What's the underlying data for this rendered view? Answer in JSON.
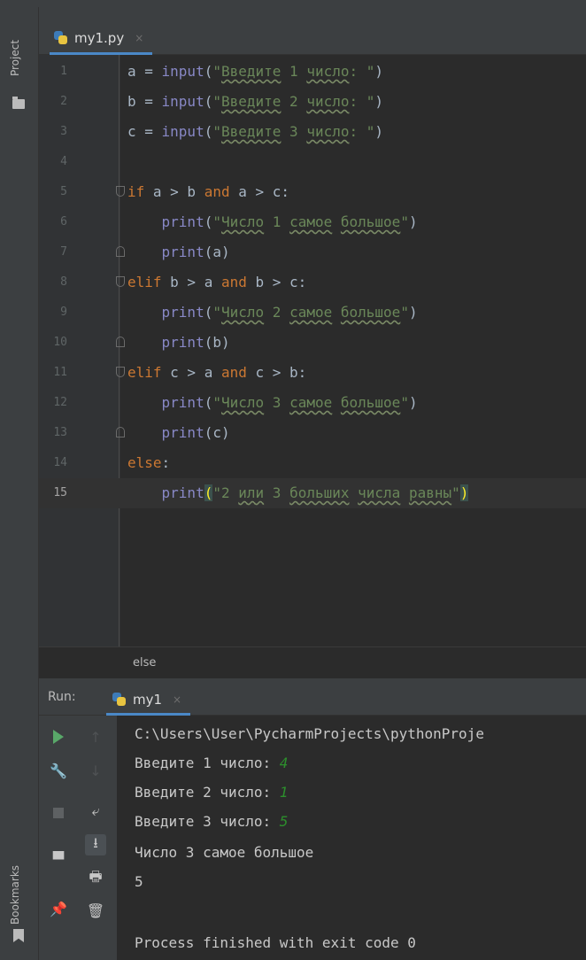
{
  "sidebar": {
    "project_label": "Project",
    "bookmarks_label": "Bookmarks"
  },
  "editor": {
    "tab": {
      "label": "my1.py",
      "close": "×"
    },
    "current_line": 15,
    "lines": [
      {
        "num": "1",
        "text": "a = input(\"Введите 1 число: \")"
      },
      {
        "num": "2",
        "text": "b = input(\"Введите 2 число: \")"
      },
      {
        "num": "3",
        "text": "c = input(\"Введите 3 число: \")"
      },
      {
        "num": "4",
        "text": ""
      },
      {
        "num": "5",
        "text": "if a > b and a > c:"
      },
      {
        "num": "6",
        "text": "    print(\"Число 1 самое большое\")"
      },
      {
        "num": "7",
        "text": "    print(a)"
      },
      {
        "num": "8",
        "text": "elif b > a and b > c:"
      },
      {
        "num": "9",
        "text": "    print(\"Число 2 самое большое\")"
      },
      {
        "num": "10",
        "text": "    print(b)"
      },
      {
        "num": "11",
        "text": "elif c > a and c > b:"
      },
      {
        "num": "12",
        "text": "    print(\"Число 3 самое большое\")"
      },
      {
        "num": "13",
        "text": "    print(c)"
      },
      {
        "num": "14",
        "text": "else:"
      },
      {
        "num": "15",
        "text": "    print(\"2 или 3 больших числа равны\")"
      }
    ],
    "breadcrumb": "else"
  },
  "run": {
    "title": "Run:",
    "tab_label": "my1",
    "tab_close": "×",
    "console": {
      "path": "C:\\Users\\User\\PycharmProjects\\pythonProje",
      "prompts": [
        {
          "prompt": "Введите 1 число: ",
          "input": "4"
        },
        {
          "prompt": "Введите 2 число: ",
          "input": "1"
        },
        {
          "prompt": "Введите 3 число: ",
          "input": "5"
        }
      ],
      "out1": "Число 3 самое большое",
      "out2": "5",
      "exit": "Process finished with exit code 0"
    }
  },
  "colors": {
    "keyword": "#cc7832",
    "builtin": "#8888c6",
    "string": "#6a8759",
    "accent": "#4a88c7",
    "user_input": "#2c8f2c"
  }
}
